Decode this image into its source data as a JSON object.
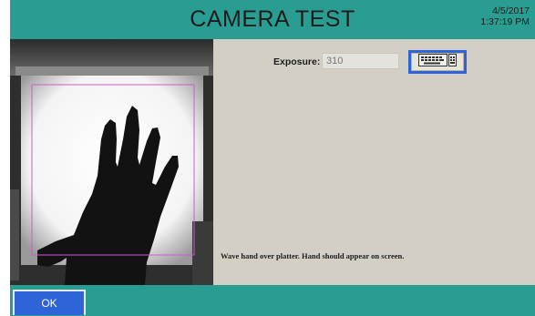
{
  "header": {
    "title": "CAMERA TEST",
    "date": "4/5/2017",
    "time": "1:37:19 PM"
  },
  "camera": {
    "content": "hand silhouette over platter"
  },
  "settings": {
    "exposure_label": "Exposure:",
    "exposure_value": "310",
    "keyboard_icon": "keyboard-icon"
  },
  "instruction": "Wave hand over platter. Hand should appear on screen.",
  "footer": {
    "ok_label": "OK"
  },
  "colors": {
    "teal": "#2a9d93",
    "blue_accent": "#2f64d8",
    "panel_bg": "#d3cfc5",
    "roi_border": "#d05ad0"
  }
}
